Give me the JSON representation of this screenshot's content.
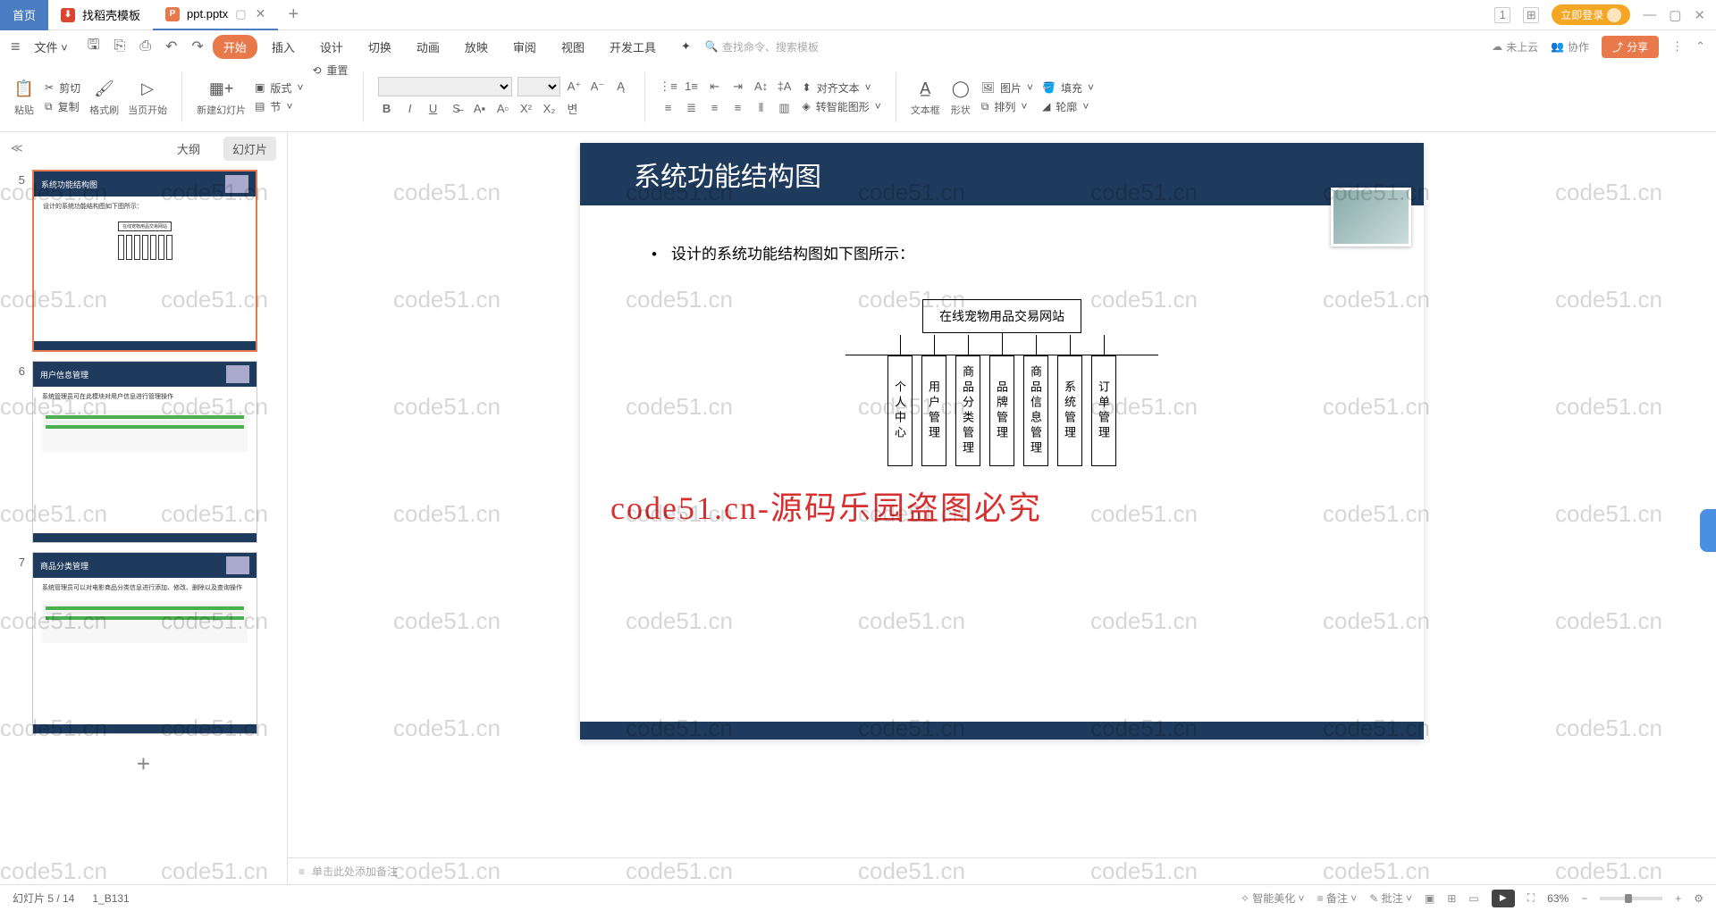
{
  "tabs": {
    "home": "首页",
    "template": "找稻壳模板",
    "file": "ppt.pptx"
  },
  "window": {
    "login": "立即登录"
  },
  "menu": {
    "file": "文件",
    "start": "开始",
    "insert": "插入",
    "design": "设计",
    "switch": "切换",
    "animation": "动画",
    "show": "放映",
    "review": "审阅",
    "view": "视图",
    "dev": "开发工具",
    "search_cmd": "查找命令、搜索模板",
    "cloud": "未上云",
    "collab": "协作",
    "share": "分享"
  },
  "ribbon": {
    "paste": "粘贴",
    "cut": "剪切",
    "copy": "复制",
    "format_brush": "格式刷",
    "page_start": "当页开始",
    "new_slide": "新建幻灯片",
    "layout": "版式",
    "reset": "重置",
    "section": "节",
    "align_text": "对齐文本",
    "smart_shape": "转智能图形",
    "textbox": "文本框",
    "shape": "形状",
    "picture": "图片",
    "fill": "填充",
    "arrange": "排列",
    "outline": "轮廓"
  },
  "side": {
    "outline": "大纲",
    "slides": "幻灯片"
  },
  "thumbs": [
    {
      "num": "5",
      "title": "系统功能结构图",
      "bullet": "设计的系统功能结构图如下图所示："
    },
    {
      "num": "6",
      "title": "用户信息管理",
      "bullet": "系统管理员可在此模块对用户信息进行管理操作"
    },
    {
      "num": "7",
      "title": "商品分类管理",
      "bullet": "系统管理员可以对电影商品分类信息进行添加、修改、删除以及查询操作"
    }
  ],
  "slide": {
    "title": "系统功能结构图",
    "bullet": "设计的系统功能结构图如下图所示：",
    "diagram_top": "在线宠物用品交易网站",
    "boxes": [
      "个人中心",
      "用户管理",
      "商品分类管理",
      "品牌管理",
      "商品信息管理",
      "系统管理",
      "订单管理"
    ]
  },
  "watermark_red": "code51.cn-源码乐园盗图必究",
  "watermark": "code51.cn",
  "notes": {
    "placeholder": "单击此处添加备注"
  },
  "status": {
    "slide_pos": "幻灯片 5 / 14",
    "layout": "1_B131",
    "beautify": "智能美化",
    "notes": "备注",
    "comments": "批注",
    "zoom": "63%"
  }
}
